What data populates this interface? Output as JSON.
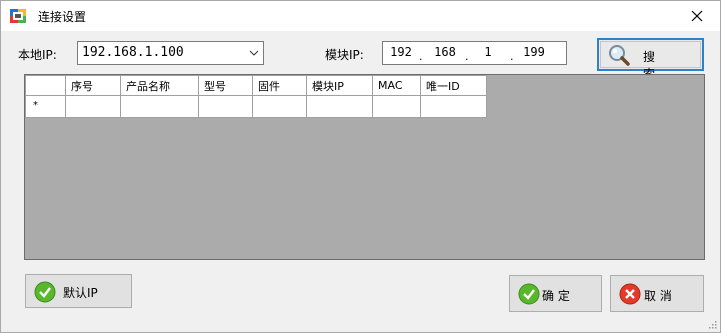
{
  "window": {
    "title": "连接设置"
  },
  "form": {
    "local_ip_label": "本地IP:",
    "local_ip_value": "192.168.1.100",
    "module_ip_label": "模块IP:",
    "module_ip": [
      "192",
      "168",
      "1",
      "199"
    ]
  },
  "buttons": {
    "search": "搜 索",
    "default_ip": "默认IP",
    "ok": "确 定",
    "cancel": "取 消"
  },
  "grid": {
    "columns": [
      "序号",
      "产品名称",
      "型号",
      "固件",
      "模块IP",
      "MAC",
      "唯一ID"
    ],
    "new_row_marker": "*"
  },
  "colors": {
    "grid_background": "#ababab",
    "search_border": "#2f7fc9",
    "ok_icon": "#58b82c",
    "cancel_icon": "#e23b2a"
  },
  "icons": {
    "app": "connection-settings-icon",
    "search": "magnifier-icon",
    "default": "check-circle-icon",
    "ok": "check-circle-icon",
    "cancel": "x-circle-icon"
  }
}
